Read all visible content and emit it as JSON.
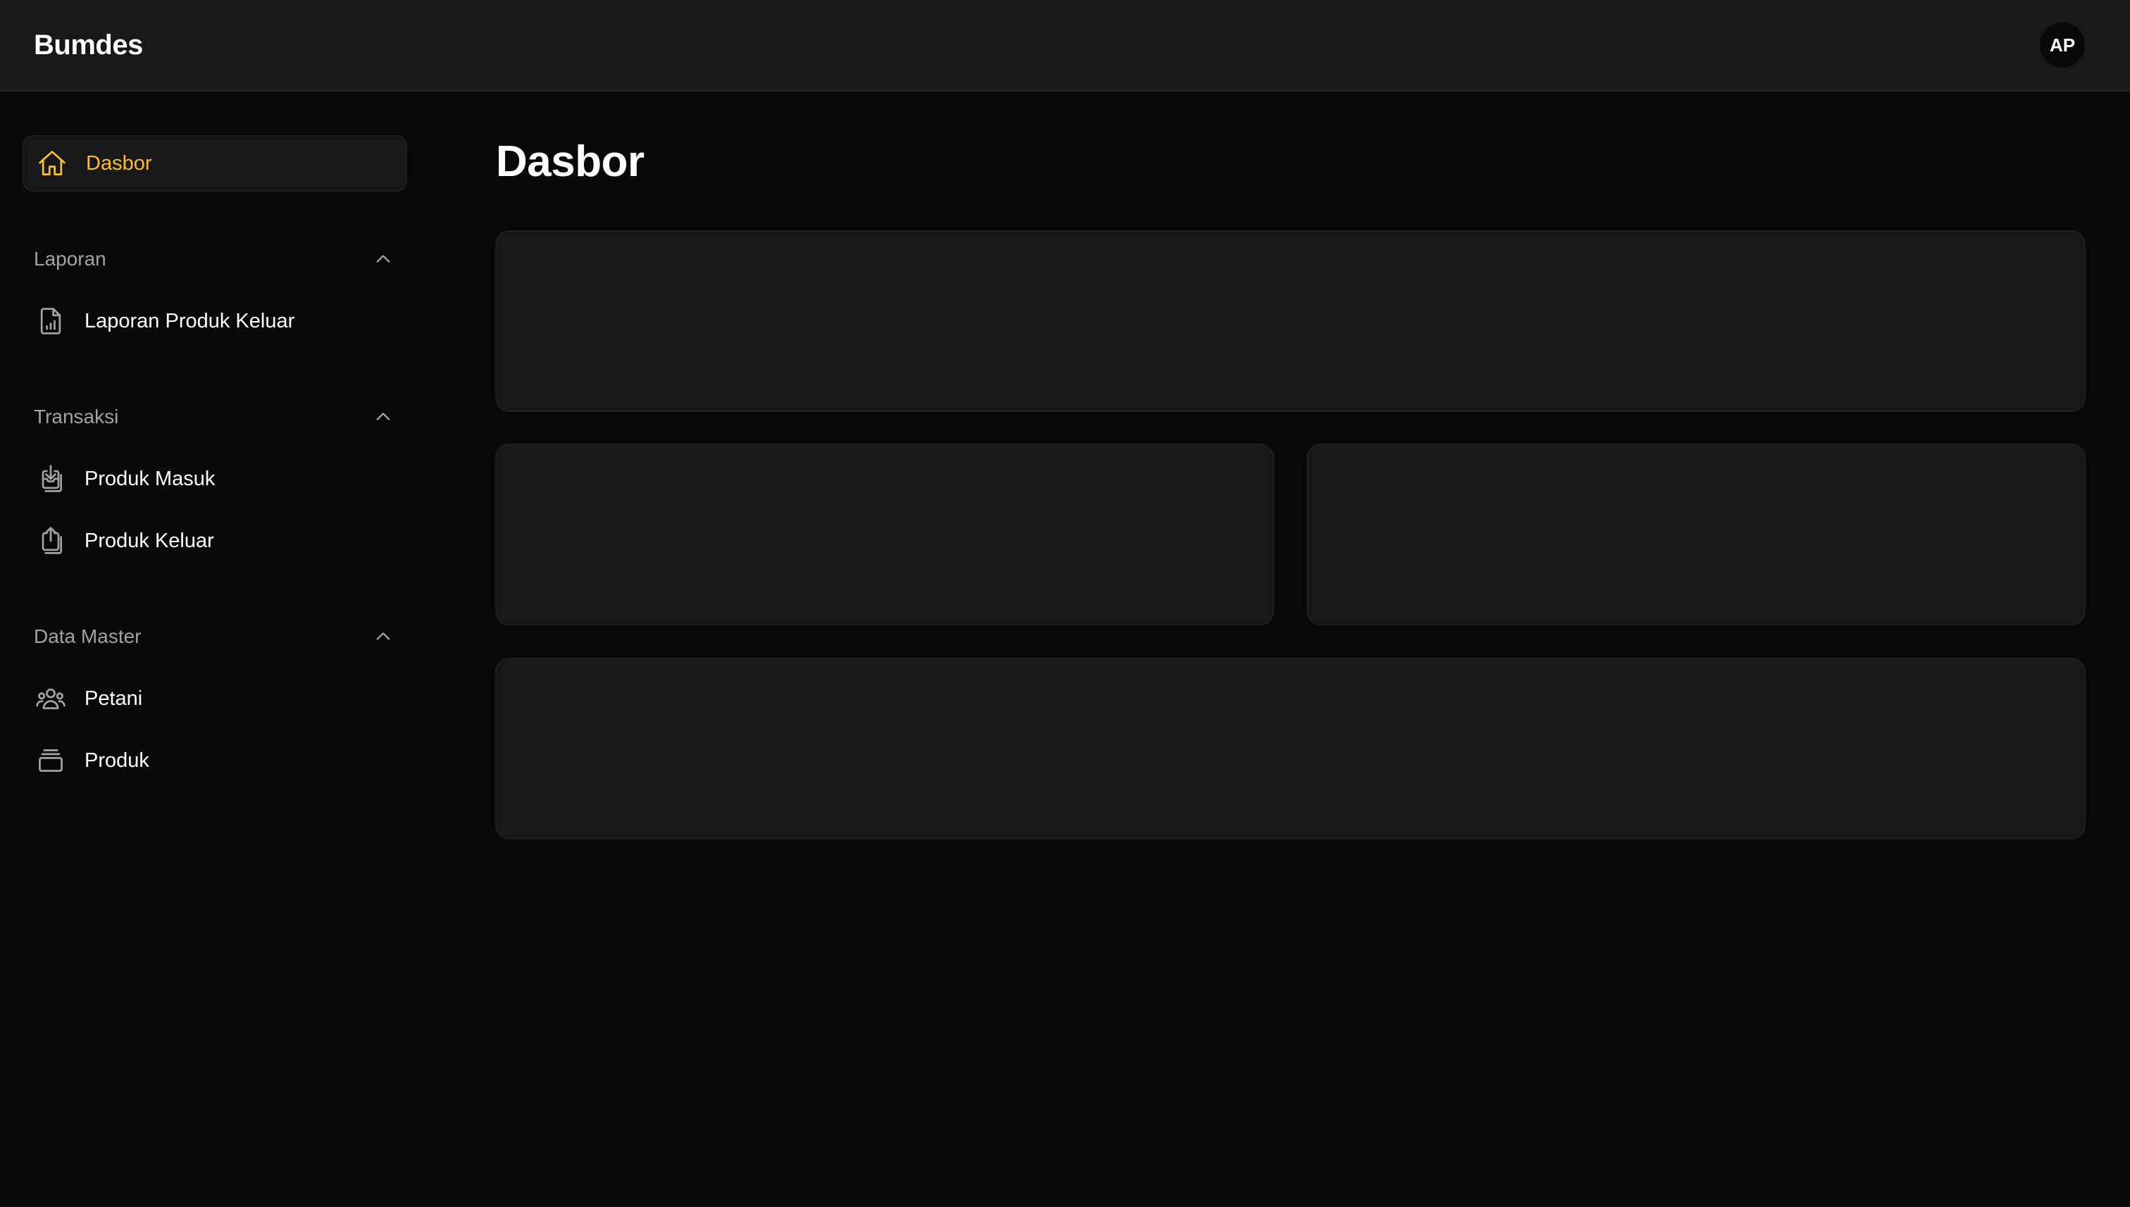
{
  "header": {
    "brand": "Bumdes",
    "avatar_initials": "AP"
  },
  "sidebar": {
    "dashboard": {
      "label": "Dasbor",
      "icon": "home-icon"
    },
    "sections": [
      {
        "title": "Laporan",
        "expanded": true,
        "items": [
          {
            "label": "Laporan Produk Keluar",
            "icon": "file-chart-icon"
          }
        ]
      },
      {
        "title": "Transaksi",
        "expanded": true,
        "items": [
          {
            "label": "Produk Masuk",
            "icon": "inbox-download-icon"
          },
          {
            "label": "Produk Keluar",
            "icon": "inbox-upload-icon"
          }
        ]
      },
      {
        "title": "Data Master",
        "expanded": true,
        "items": [
          {
            "label": "Petani",
            "icon": "users-icon"
          },
          {
            "label": "Produk",
            "icon": "box-icon"
          }
        ]
      }
    ]
  },
  "main": {
    "title": "Dasbor"
  },
  "colors": {
    "accent": "#fbbf24",
    "background": "#09090b",
    "surface": "#18181b",
    "muted_text": "#a1a1aa"
  }
}
